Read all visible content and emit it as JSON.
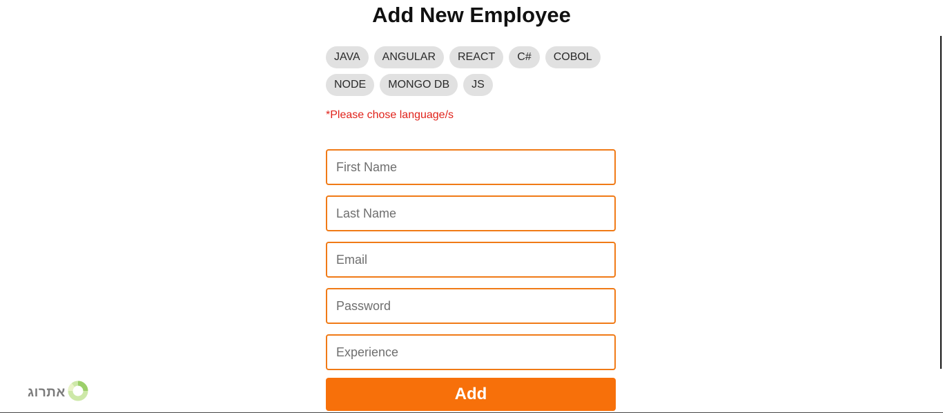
{
  "page": {
    "title": "Add New Employee"
  },
  "languages": {
    "row1": [
      "JAVA",
      "ANGULAR",
      "REACT",
      "C#",
      "COBOL"
    ],
    "row2": [
      "NODE",
      "MONGO DB",
      "JS"
    ]
  },
  "error": "*Please chose language/s",
  "form": {
    "first_name_placeholder": "First Name",
    "last_name_placeholder": "Last Name",
    "email_placeholder": "Email",
    "password_placeholder": "Password",
    "experience_placeholder": "Experience",
    "add_label": "Add"
  },
  "logo": {
    "text": "אתרוג",
    "icon": "ring-logo-icon"
  },
  "colors": {
    "accent": "#f7700a",
    "border": "#f07a16",
    "error": "#e0221a",
    "chip": "#e1e1e1"
  }
}
